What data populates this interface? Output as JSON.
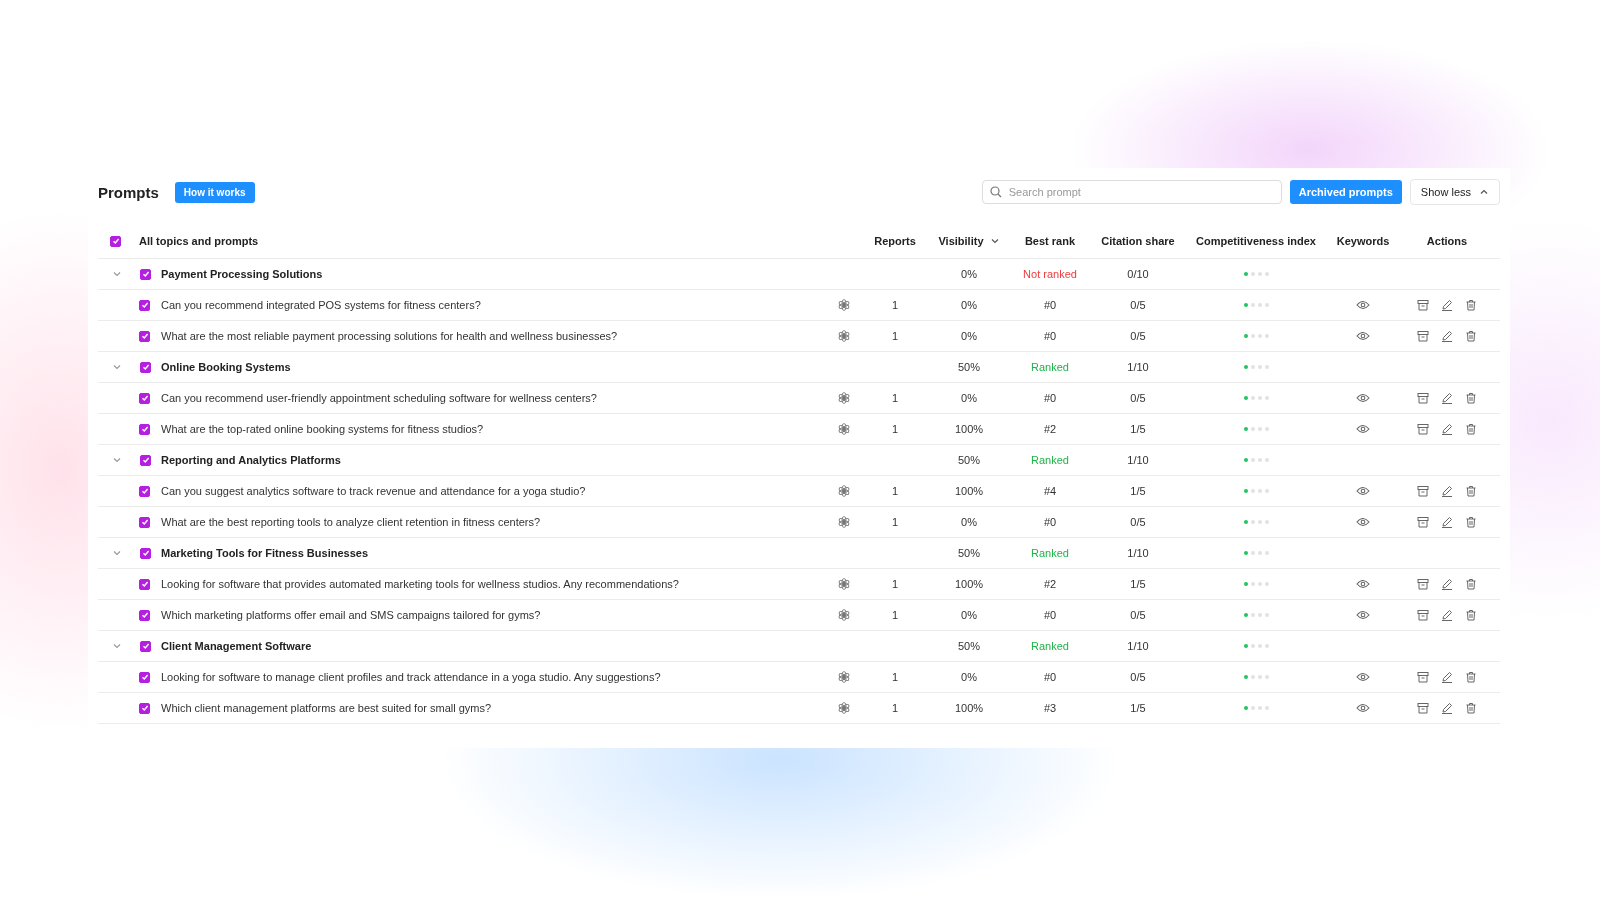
{
  "header": {
    "title": "Prompts",
    "help_button": "How it works",
    "search": {
      "placeholder": "Search prompt"
    },
    "archived_button": "Archived prompts",
    "toggle_button": "Show less"
  },
  "table": {
    "select_all": {
      "label": "All topics and prompts",
      "checked": true
    },
    "columns": [
      "Reports",
      "Visibility",
      "Best rank",
      "Citation share",
      "Competitiveness index",
      "Keywords",
      "Actions"
    ],
    "groups": [
      {
        "name": "Payment Processing Solutions",
        "checked": true,
        "expanded": true,
        "visibility": "0%",
        "rank_status": "Not ranked",
        "ranked": false,
        "citation_share": "0/10",
        "stars": 1,
        "prompts": [
          {
            "text": "Can you recommend integrated POS systems for fitness centers?",
            "checked": true,
            "reports": "1",
            "visibility": "0%",
            "best_rank": "#0",
            "citation_share": "0/5",
            "stars": 1
          },
          {
            "text": "What are the most reliable payment processing solutions for health and wellness businesses?",
            "checked": true,
            "reports": "1",
            "visibility": "0%",
            "best_rank": "#0",
            "citation_share": "0/5",
            "stars": 1
          }
        ]
      },
      {
        "name": "Online Booking Systems",
        "checked": true,
        "expanded": true,
        "visibility": "50%",
        "rank_status": "Ranked",
        "ranked": true,
        "citation_share": "1/10",
        "stars": 1,
        "prompts": [
          {
            "text": "Can you recommend user-friendly appointment scheduling software for wellness centers?",
            "checked": true,
            "reports": "1",
            "visibility": "0%",
            "best_rank": "#0",
            "citation_share": "0/5",
            "stars": 1
          },
          {
            "text": "What are the top-rated online booking systems for fitness studios?",
            "checked": true,
            "reports": "1",
            "visibility": "100%",
            "best_rank": "#2",
            "citation_share": "1/5",
            "stars": 1
          }
        ]
      },
      {
        "name": "Reporting and Analytics Platforms",
        "checked": true,
        "expanded": true,
        "visibility": "50%",
        "rank_status": "Ranked",
        "ranked": true,
        "citation_share": "1/10",
        "stars": 1,
        "prompts": [
          {
            "text": "Can you suggest analytics software to track revenue and attendance for a yoga studio?",
            "checked": true,
            "reports": "1",
            "visibility": "100%",
            "best_rank": "#4",
            "citation_share": "1/5",
            "stars": 1
          },
          {
            "text": "What are the best reporting tools to analyze client retention in fitness centers?",
            "checked": true,
            "reports": "1",
            "visibility": "0%",
            "best_rank": "#0",
            "citation_share": "0/5",
            "stars": 1
          }
        ]
      },
      {
        "name": "Marketing Tools for Fitness Businesses",
        "checked": true,
        "expanded": true,
        "visibility": "50%",
        "rank_status": "Ranked",
        "ranked": true,
        "citation_share": "1/10",
        "stars": 1,
        "prompts": [
          {
            "text": "Looking for software that provides automated marketing tools for wellness studios. Any recommendations?",
            "checked": true,
            "reports": "1",
            "visibility": "100%",
            "best_rank": "#2",
            "citation_share": "1/5",
            "stars": 1
          },
          {
            "text": "Which marketing platforms offer email and SMS campaigns tailored for gyms?",
            "checked": true,
            "reports": "1",
            "visibility": "0%",
            "best_rank": "#0",
            "citation_share": "0/5",
            "stars": 1
          }
        ]
      },
      {
        "name": "Client Management Software",
        "checked": true,
        "expanded": true,
        "visibility": "50%",
        "rank_status": "Ranked",
        "ranked": true,
        "citation_share": "1/10",
        "stars": 1,
        "prompts": [
          {
            "text": "Looking for software to manage client profiles and track attendance in a yoga studio. Any suggestions?",
            "checked": true,
            "reports": "1",
            "visibility": "0%",
            "best_rank": "#0",
            "citation_share": "0/5",
            "stars": 1
          },
          {
            "text": "Which client management platforms are best suited for small gyms?",
            "checked": true,
            "reports": "1",
            "visibility": "100%",
            "best_rank": "#3",
            "citation_share": "1/5",
            "stars": 1
          }
        ]
      }
    ]
  }
}
